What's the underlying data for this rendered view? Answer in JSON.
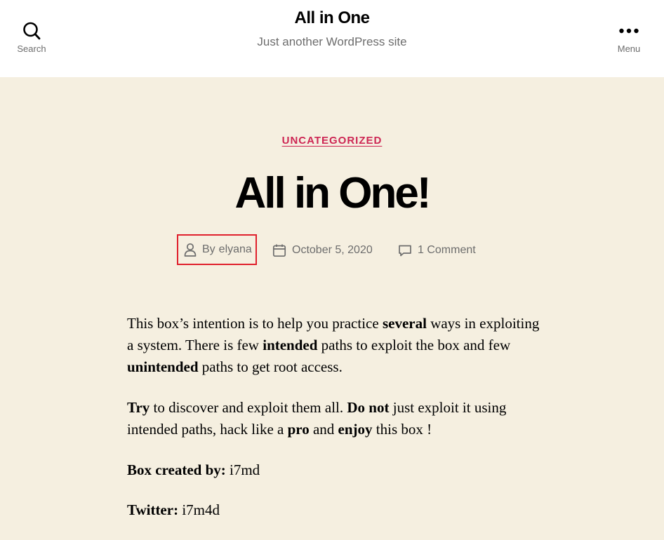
{
  "header": {
    "search_label": "Search",
    "menu_label": "Menu",
    "site_title": "All in One",
    "site_description": "Just another WordPress site"
  },
  "post": {
    "category": "UNCATEGORIZED",
    "title": "All in One!",
    "meta": {
      "author_prefix": "By",
      "author": "elyana",
      "date": "October 5, 2020",
      "comments": "1 Comment"
    },
    "body": {
      "p1_a": "This box’s intention is to help you practice ",
      "p1_b": "several",
      "p1_c": " ways in exploiting a system. There is few ",
      "p1_d": "intended",
      "p1_e": " paths to exploit the box and few ",
      "p1_f": "unintended",
      "p1_g": " paths to get root access.",
      "p2_a": "Try",
      "p2_b": " to discover and exploit them all. ",
      "p2_c": "Do not",
      "p2_d": " just exploit it using intended paths, hack like a ",
      "p2_e": "pro",
      "p2_f": " and ",
      "p2_g": "enjoy",
      "p2_h": " this box !",
      "p3_label": "Box created by:",
      "p3_value": " i7md",
      "p4_label": "Twitter:",
      "p4_value": " i7m4d"
    }
  },
  "colors": {
    "accent": "#cd2653",
    "background": "#f5efe0",
    "highlight_box": "#e0202c"
  }
}
